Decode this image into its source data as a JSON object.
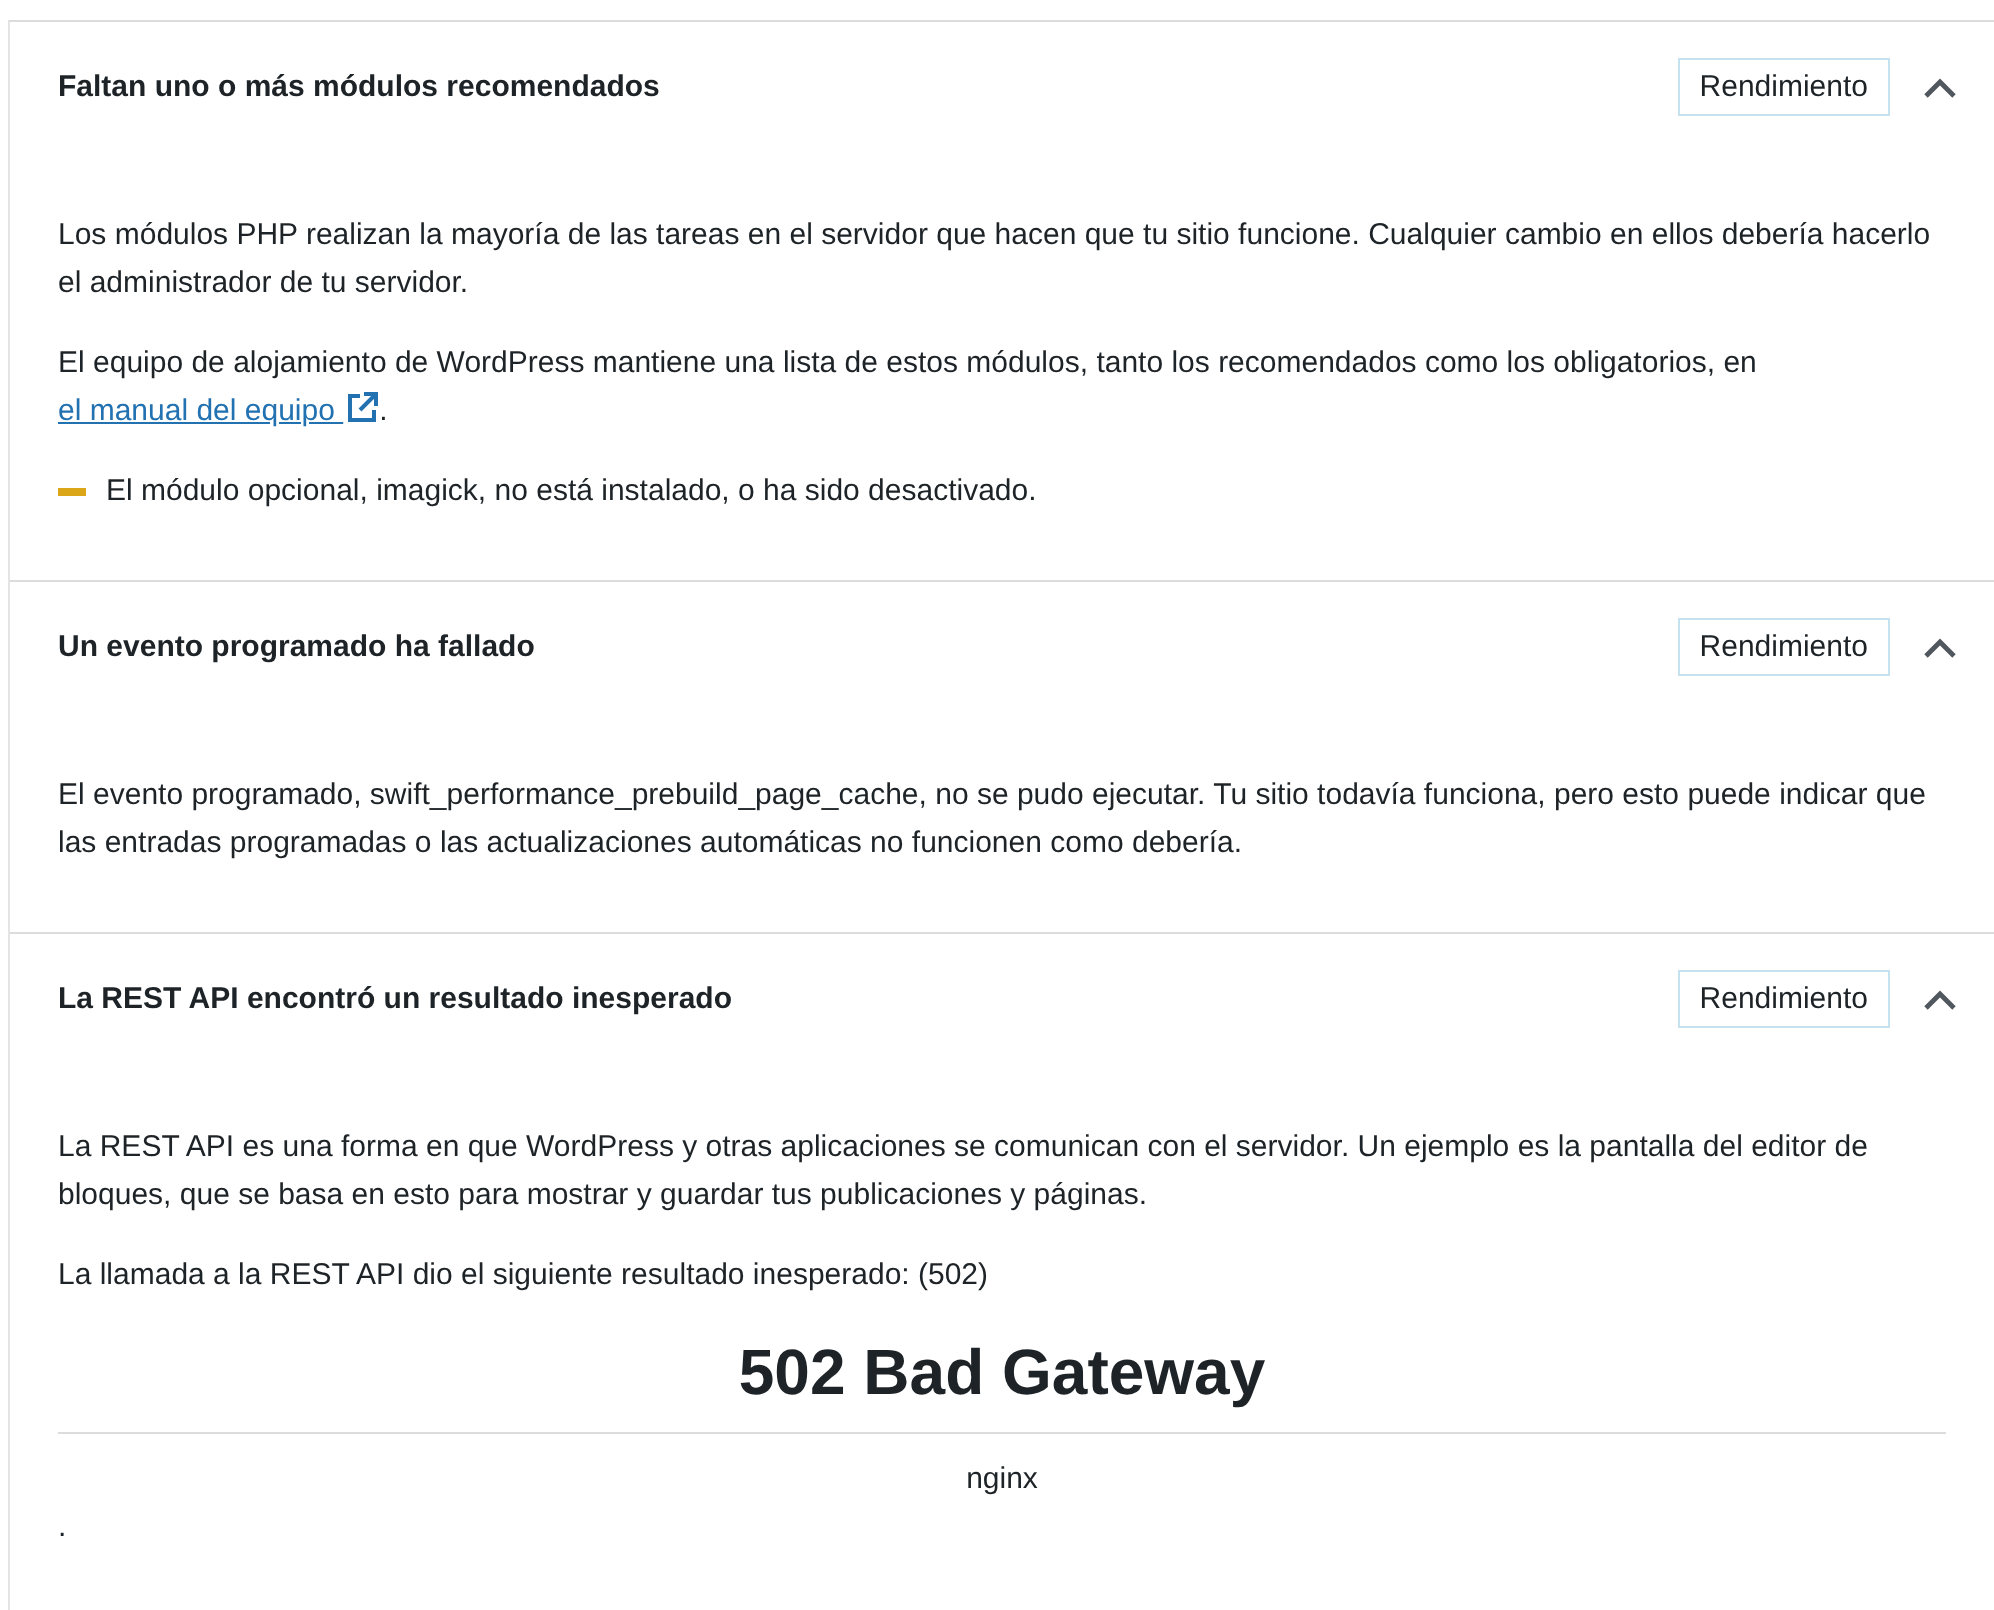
{
  "sections": [
    {
      "title": "Faltan uno o más módulos recomendados",
      "badge": "Rendimiento",
      "expanded": true,
      "blocks": [
        {
          "kind": "paragraph",
          "text": "Los módulos PHP realizan la mayoría de las tareas en el servidor que hacen que tu sitio funcione. Cualquier cambio en ellos debería hacerlo el administrador de tu servidor."
        },
        {
          "kind": "paragraph",
          "text": "El equipo de alojamiento de WordPress mantiene una lista de estos módulos, tanto los recomendados como los obligatorios, en ",
          "link": "el manual del equipo",
          "after": "."
        },
        {
          "kind": "warning",
          "text": "El módulo opcional, imagick, no está instalado, o ha sido desactivado."
        }
      ]
    },
    {
      "title": "Un evento programado ha fallado",
      "badge": "Rendimiento",
      "expanded": true,
      "blocks": [
        {
          "kind": "paragraph",
          "text": "El evento programado, swift_performance_prebuild_page_cache, no se pudo ejecutar. Tu sitio todavía funciona, pero esto puede indicar que las entradas programadas o las actualizaciones automáticas no funcionen como debería."
        }
      ]
    },
    {
      "title": "La REST API encontró un resultado inesperado",
      "badge": "Rendimiento",
      "expanded": true,
      "blocks": [
        {
          "kind": "paragraph",
          "text": "La REST API es una forma en que WordPress y otras aplicaciones se comunican con el servidor. Un ejemplo es la pantalla del editor de bloques, que se basa en esto para mostrar y guardar tus publicaciones y páginas."
        },
        {
          "kind": "paragraph",
          "text": "La llamada a la REST API dio el siguiente resultado inesperado: (502)"
        },
        {
          "kind": "heading",
          "text": "502 Bad Gateway"
        },
        {
          "kind": "rule"
        },
        {
          "kind": "centered",
          "text": "nginx"
        },
        {
          "kind": "paragraph",
          "text": "."
        }
      ]
    }
  ]
}
